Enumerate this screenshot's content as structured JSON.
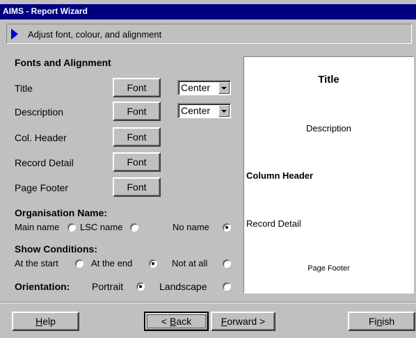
{
  "window": {
    "title": "AIMS - Report Wizard"
  },
  "step": {
    "text": "Adjust font, colour, and alignment"
  },
  "fonts_section": {
    "heading": "Fonts and Alignment",
    "rows": [
      {
        "label": "Title",
        "font_button": "Font",
        "alignment": "Center"
      },
      {
        "label": "Description",
        "font_button": "Font",
        "alignment": "Center"
      },
      {
        "label": "Col. Header",
        "font_button": "Font"
      },
      {
        "label": "Record Detail",
        "font_button": "Font"
      },
      {
        "label": "Page Footer",
        "font_button": "Font"
      }
    ]
  },
  "organisation": {
    "heading": "Organisation Name:",
    "options": [
      {
        "label": "Main name",
        "selected": false
      },
      {
        "label": "LSC name",
        "selected": false
      },
      {
        "label": "No name",
        "selected": true
      }
    ]
  },
  "conditions": {
    "heading": "Show Conditions:",
    "options": [
      {
        "label": "At the start",
        "selected": false
      },
      {
        "label": "At the end",
        "selected": true
      },
      {
        "label": "Not at all",
        "selected": false
      }
    ]
  },
  "orientation": {
    "heading": "Orientation:",
    "options": [
      {
        "label": "Portrait",
        "selected": true
      },
      {
        "label": "Landscape",
        "selected": false
      }
    ]
  },
  "preview": {
    "title": "Title",
    "description": "Description",
    "column_header": "Column Header",
    "record_detail": "Record Detail",
    "page_footer": "Page Footer"
  },
  "buttons": {
    "help": {
      "mnemonic": "H",
      "rest": "elp"
    },
    "back": {
      "prefix": "< ",
      "mnemonic": "B",
      "rest": "ack"
    },
    "forward": {
      "mnemonic": "F",
      "rest": "orward >"
    },
    "finish": {
      "start": "Fi",
      "mnemonic": "n",
      "rest": "ish"
    }
  },
  "colors": {
    "titlebar": "#000080",
    "face": "#c0c0c0",
    "step_arrow": "#0000e0"
  }
}
